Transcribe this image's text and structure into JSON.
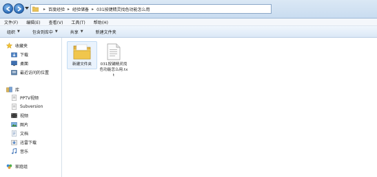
{
  "address": {
    "breadcrumbs": [
      "百度经验",
      "经验储备",
      "031按键精灵找色功能怎么用"
    ]
  },
  "menu": [
    "文件(F)",
    "编辑(E)",
    "查看(V)",
    "工具(T)",
    "帮助(H)"
  ],
  "commands": [
    {
      "label": "组织",
      "dropdown": true
    },
    {
      "label": "包含到库中",
      "dropdown": true
    },
    {
      "label": "共享",
      "dropdown": true
    },
    {
      "label": "新建文件夹",
      "dropdown": false
    }
  ],
  "sidebar": {
    "favorites": {
      "label": "收藏夹",
      "items": [
        "下载",
        "桌面",
        "最近访问的位置"
      ]
    },
    "libraries": {
      "label": "库",
      "items": [
        "PPTV视频",
        "Subversion",
        "视频",
        "图片",
        "文档",
        "迅雷下载",
        "音乐"
      ]
    },
    "homegroup": {
      "label": "家庭组"
    }
  },
  "files": [
    {
      "name": "新建文件夹",
      "type": "folder",
      "icon": "folder-icon"
    },
    {
      "name": "031按键精灵找色功能怎么用.txt",
      "type": "text",
      "icon": "text-file-icon"
    }
  ]
}
